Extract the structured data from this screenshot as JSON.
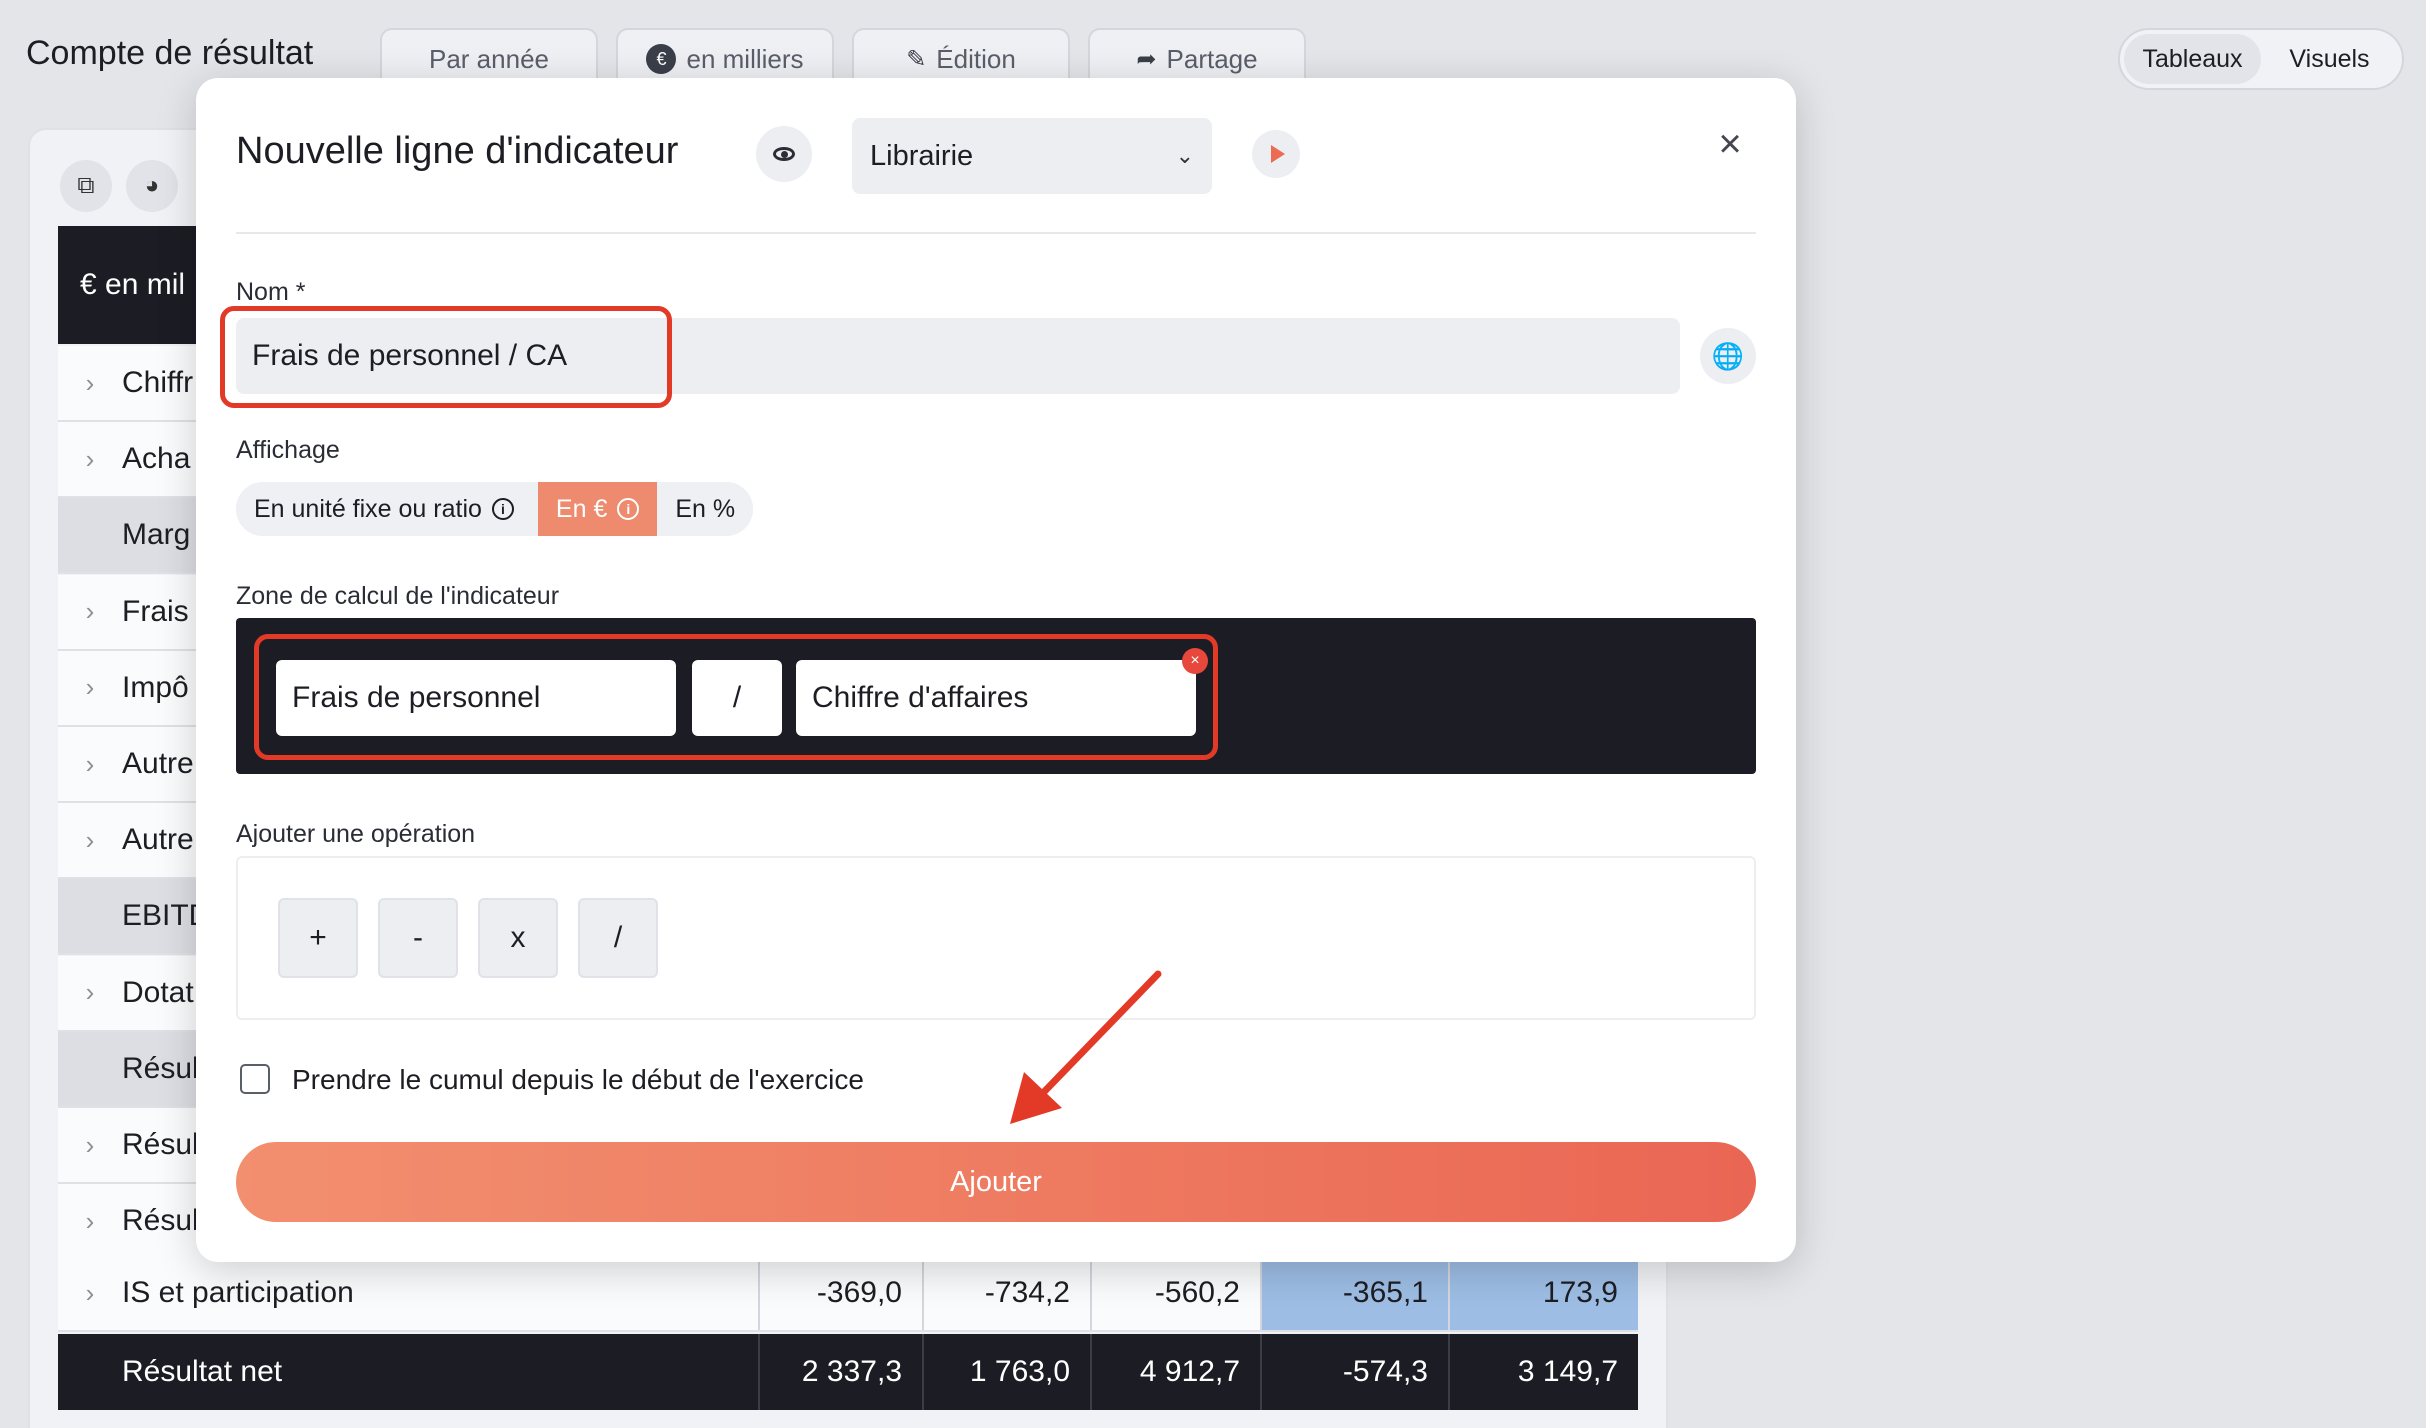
{
  "page": {
    "title": "Compte de résultat",
    "toolbar": {
      "by_year": "Par année",
      "thousands": "en milliers",
      "edit": "Édition",
      "share": "Partage"
    },
    "view_toggle": {
      "tables": "Tableaux",
      "visuals": "Visuels"
    }
  },
  "table": {
    "header_label": "€ en mil",
    "rows": [
      {
        "label": "Chiffr",
        "expandable": true,
        "shaded": false
      },
      {
        "label": "Acha",
        "expandable": true,
        "shaded": false
      },
      {
        "label": "Marg",
        "expandable": false,
        "shaded": true
      },
      {
        "label": "Frais",
        "expandable": true,
        "shaded": false
      },
      {
        "label": "Impô",
        "expandable": true,
        "shaded": false
      },
      {
        "label": "Autre",
        "expandable": true,
        "shaded": false
      },
      {
        "label": "Autre",
        "expandable": true,
        "shaded": false
      },
      {
        "label": "EBITD",
        "expandable": false,
        "shaded": true
      },
      {
        "label": "Dotat",
        "expandable": true,
        "shaded": false
      },
      {
        "label": "Résul",
        "expandable": false,
        "shaded": true
      },
      {
        "label": "Résul",
        "expandable": true,
        "shaded": false
      },
      {
        "label": "Résul",
        "expandable": true,
        "shaded": false
      }
    ],
    "is_row": {
      "label": "IS et participation",
      "values": [
        "-369,0",
        "-734,2",
        "-560,2",
        "-365,1",
        "173,9"
      ]
    },
    "net_row": {
      "label": "Résultat net",
      "values": [
        "2 337,3",
        "1 763,0",
        "4 912,7",
        "-574,3",
        "3 149,7"
      ]
    }
  },
  "modal": {
    "title": "Nouvelle ligne d'indicateur",
    "library_select": "Librairie",
    "name_label": "Nom *",
    "name_value": "Frais de personnel / CA",
    "display_label": "Affichage",
    "display_options": [
      "En unité fixe ou ratio",
      "En €",
      "En %"
    ],
    "display_selected": "En €",
    "calc_zone_label": "Zone de calcul de l'indicateur",
    "calc_tokens": {
      "left": "Frais de personnel",
      "operator": "/",
      "right": "Chiffre d'affaires"
    },
    "add_op_label": "Ajouter une opération",
    "operations": [
      "+",
      "-",
      "x",
      "/"
    ],
    "cumulative_label": "Prendre le cumul depuis le début de l'exercice",
    "cumulative_checked": false,
    "submit_label": "Ajouter"
  },
  "colors": {
    "accent": "#ee7a60",
    "highlight": "#e33a27",
    "dark": "#1c1d24",
    "blue_cell": "#9dbde4"
  }
}
